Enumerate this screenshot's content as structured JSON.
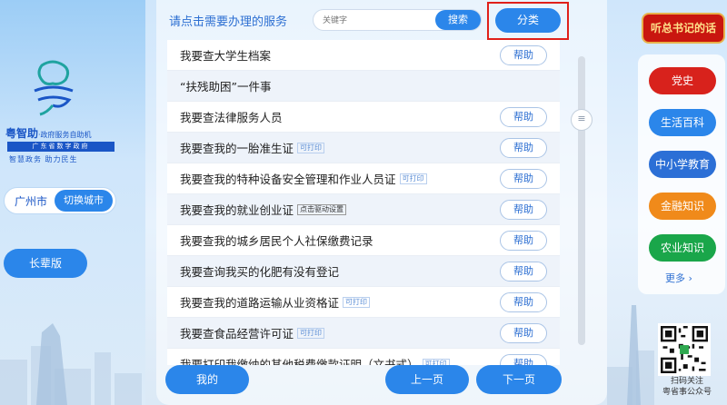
{
  "brand": {
    "title": "粤智助",
    "subtitle": "·政府服务自助机",
    "bar": "广东省数字政府",
    "slogan": "智慧政务  助力民生"
  },
  "city": {
    "name": "广州市",
    "switch_label": "切换城市"
  },
  "elder_mode_label": "长辈版",
  "header": {
    "prompt": "请点击需要办理的服务",
    "search_placeholder": "关键字",
    "search_label": "搜索",
    "category_label": "分类"
  },
  "services": [
    {
      "label": "我要查大学生档案",
      "tag": "",
      "has_help": true
    },
    {
      "label": "“扶残助困”一件事",
      "tag": "",
      "has_help": false
    },
    {
      "label": "我要查法律服务人员",
      "tag": "",
      "has_help": true
    },
    {
      "label": "我要查我的一胎准生证",
      "tag": "可打印",
      "has_help": true
    },
    {
      "label": "我要查我的特种设备安全管理和作业人员证",
      "tag": "可打印",
      "has_help": true
    },
    {
      "label": "我要查我的就业创业证",
      "tag": "点击驱动设置",
      "has_help": true
    },
    {
      "label": "我要查我的城乡居民个人社保缴费记录",
      "tag": "",
      "has_help": true
    },
    {
      "label": "我要查询我买的化肥有没有登记",
      "tag": "",
      "has_help": true
    },
    {
      "label": "我要查我的道路运输从业资格证",
      "tag": "可打印",
      "has_help": true
    },
    {
      "label": "我要查食品经营许可证",
      "tag": "可打印",
      "has_help": true
    },
    {
      "label": "我要打印我缴纳的其他税费缴款证明（文书式）",
      "tag": "可打印",
      "has_help": true
    }
  ],
  "help_label": "帮助",
  "footer": {
    "mine": "我的",
    "prev": "上一页",
    "next": "下一页"
  },
  "right": {
    "xi_label": "听总书记的话",
    "items": [
      {
        "label": "党史",
        "color": "#d8221c"
      },
      {
        "label": "生活百科",
        "color": "#2b86ea"
      },
      {
        "label": "中小学教育",
        "color": "#2b6fd6"
      },
      {
        "label": "金融知识",
        "color": "#f08a1a"
      },
      {
        "label": "农业知识",
        "color": "#1aa64a"
      }
    ],
    "more_label": "更多 ›",
    "qr_caption_1": "扫码关注",
    "qr_caption_2": "粤省事公众号"
  }
}
